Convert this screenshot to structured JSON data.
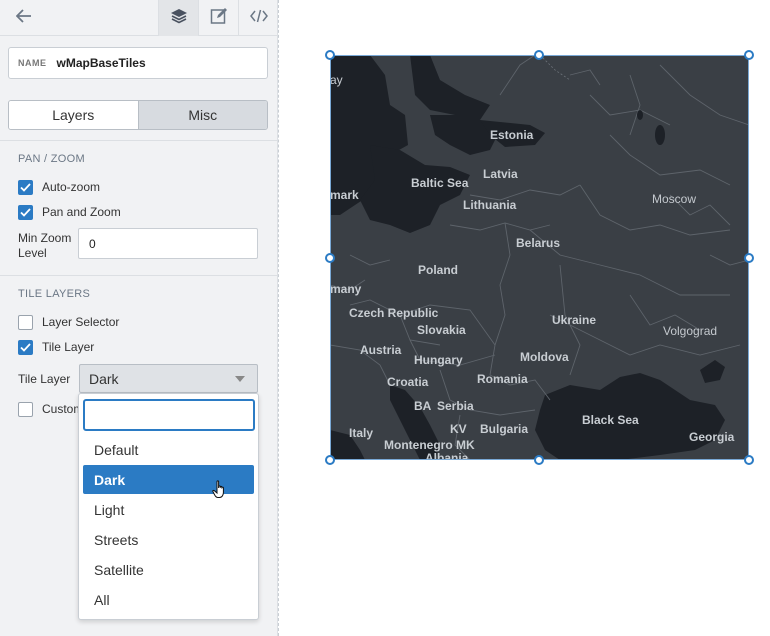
{
  "toolbar": {
    "back_icon": "arrow-left-icon",
    "tabs": [
      {
        "icon": "layers-icon",
        "active": true
      },
      {
        "icon": "edit-icon",
        "active": false
      },
      {
        "icon": "code-icon",
        "active": false
      }
    ]
  },
  "name_field": {
    "label": "NAME",
    "value": "wMapBaseTiles"
  },
  "segmented": {
    "options": [
      "Layers",
      "Misc"
    ],
    "selected": "Misc"
  },
  "pan_zoom": {
    "title": "PAN / ZOOM",
    "auto_zoom": {
      "label": "Auto-zoom",
      "checked": true
    },
    "pan_and_zoom": {
      "label": "Pan and Zoom",
      "checked": true
    },
    "min_zoom": {
      "label": "Min Zoom Level",
      "value": "0"
    }
  },
  "tile_layers": {
    "title": "TILE LAYERS",
    "layer_selector": {
      "label": "Layer Selector",
      "checked": false
    },
    "tile_layer_checkbox": {
      "label": "Tile Layer",
      "checked": true
    },
    "tile_layer_select": {
      "label": "Tile Layer",
      "value": "Dark"
    },
    "custom": {
      "label": "Custom",
      "checked": false
    }
  },
  "dropdown": {
    "search_value": "",
    "options": [
      "Default",
      "Dark",
      "Light",
      "Streets",
      "Satellite",
      "All"
    ],
    "highlighted": "Dark"
  },
  "map": {
    "labels": {
      "ay": "ay",
      "estonia": "Estonia",
      "baltic_sea": "Baltic Sea",
      "latvia": "Latvia",
      "mark": "mark",
      "moscow": "Moscow",
      "lithuania": "Lithuania",
      "belarus": "Belarus",
      "poland": "Poland",
      "many": "many",
      "czech": "Czech Republic",
      "ukraine": "Ukraine",
      "slovakia": "Slovakia",
      "volgograd": "Volgograd",
      "austria": "Austria",
      "moldova": "Moldova",
      "hungary": "Hungary",
      "croatia": "Croatia",
      "romania": "Romania",
      "ba": "BA",
      "serbia": "Serbia",
      "black_sea": "Black Sea",
      "italy": "Italy",
      "kv": "KV",
      "bulgaria": "Bulgaria",
      "georgia": "Georgia",
      "montenegro": "Montenegro",
      "mk": "MK",
      "albania": "Albania"
    },
    "colors": {
      "land": "#3a3f45",
      "water": "#1d2127",
      "border": "#5e646b"
    }
  },
  "colors": {
    "accent": "#2b7bc4",
    "panel_bg": "#f1f2f4"
  }
}
